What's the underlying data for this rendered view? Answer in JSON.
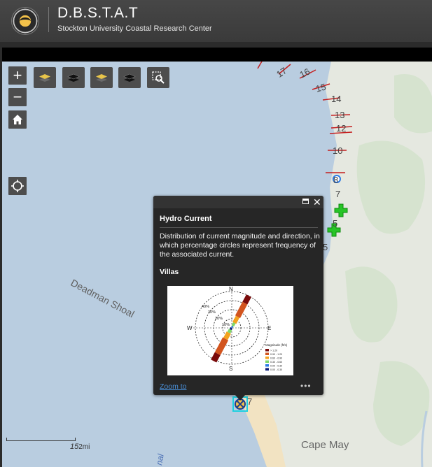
{
  "header": {
    "title": "D.B.S.T.A.T",
    "subtitle": "Stockton University Coastal Research Center",
    "logo_icon": "university-seal-icon"
  },
  "map_controls": {
    "zoom_in": "+",
    "zoom_out": "−",
    "home_icon": "home-icon",
    "locate_icon": "locate-crosshair-icon",
    "layer_buttons": [
      "layers-icon-yellow",
      "layers-icon-dark",
      "layers-icon-yellow",
      "layers-icon-dark",
      "search-zoom-icon"
    ]
  },
  "map_labels": {
    "shoal": "Deadman Shoal",
    "place": "Cape May",
    "scale": "2mi",
    "scale_number": "15"
  },
  "contour_labels": [
    "17",
    "16",
    "15",
    "14",
    "13",
    "12",
    "10",
    "8",
    "7",
    "5",
    "5",
    "7"
  ],
  "popup": {
    "title": "Hydro Current",
    "description": "Distribution of current magnitude and direction, in which percentage circles represent frequency of the associated current.",
    "site": "Villas",
    "zoom_link": "Zoom to",
    "more": "•••",
    "close": "✕"
  },
  "rose_chart": {
    "directions": [
      "N",
      "E",
      "S",
      "W"
    ],
    "rings": [
      "10%",
      "20%",
      "30%",
      "40%"
    ],
    "legend_title": "Magnitude (ft/s)",
    "legend": [
      {
        "label": "> 1.20",
        "color": "#7a0b0b"
      },
      {
        "label": "0.90 - 1.20",
        "color": "#d2541e"
      },
      {
        "label": "0.60 - 0.90",
        "color": "#f3a21f"
      },
      {
        "label": "0.30 - 0.60",
        "color": "#7fd86b"
      },
      {
        "label": "0.00 - 0.30",
        "color": "#2c7be5"
      },
      {
        "label": "0.00 - 0.30",
        "color": "#0a1a7a"
      }
    ]
  }
}
